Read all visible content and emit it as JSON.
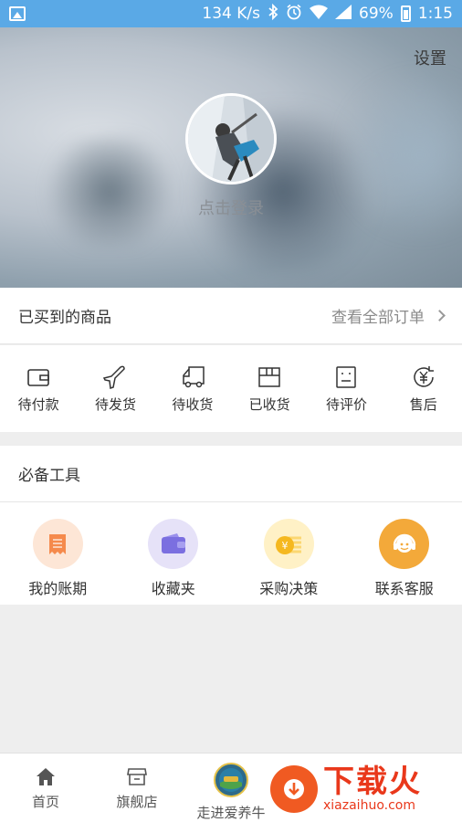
{
  "status_bar": {
    "network_speed": "134 K/s",
    "battery": "69%",
    "time": "1:15"
  },
  "header": {
    "settings_label": "设置",
    "login_label": "点击登录"
  },
  "orders": {
    "title": "已买到的商品",
    "view_all": "查看全部订单",
    "items": [
      {
        "label": "待付款",
        "icon": "wallet-icon"
      },
      {
        "label": "待发货",
        "icon": "plane-icon"
      },
      {
        "label": "待收货",
        "icon": "truck-icon"
      },
      {
        "label": "已收货",
        "icon": "box-icon"
      },
      {
        "label": "待评价",
        "icon": "review-icon"
      },
      {
        "label": "售后",
        "icon": "yuan-refresh-icon"
      }
    ]
  },
  "tools": {
    "title": "必备工具",
    "items": [
      {
        "label": "我的账期",
        "icon": "bill-icon",
        "color": "#f59a62"
      },
      {
        "label": "收藏夹",
        "icon": "folder-icon",
        "color": "#7b6fe0"
      },
      {
        "label": "采购决策",
        "icon": "coin-icon",
        "color": "#f6c343"
      },
      {
        "label": "联系客服",
        "icon": "headset-icon",
        "color": "#f3a93a"
      }
    ]
  },
  "tabbar": {
    "items": [
      {
        "label": "首页",
        "icon": "home-icon"
      },
      {
        "label": "旗舰店",
        "icon": "store-icon"
      },
      {
        "label": "走进爱养牛",
        "icon": "brand-badge-icon"
      }
    ]
  },
  "watermark": {
    "main": "下载火",
    "sub": "xiazaihuo.com"
  }
}
